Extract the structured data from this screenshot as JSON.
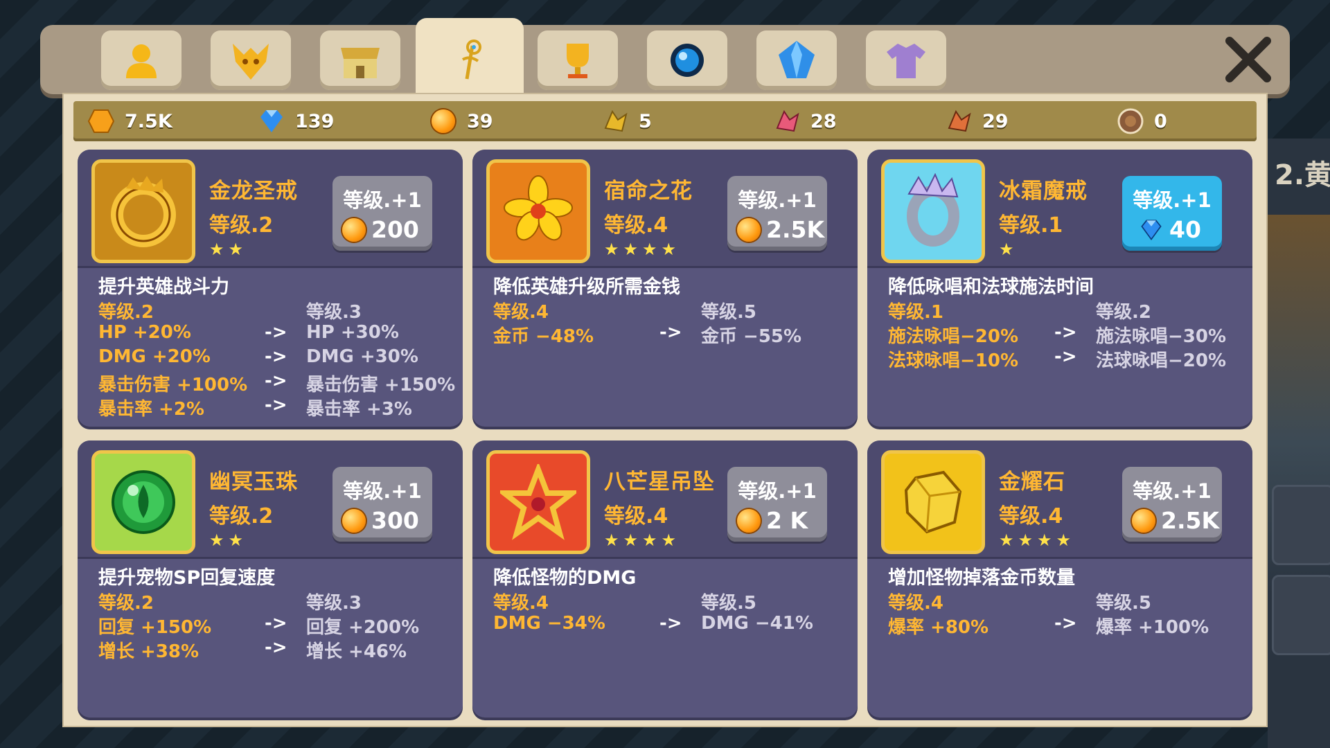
{
  "tabs": [
    {
      "icon": "hero-icon",
      "active": false
    },
    {
      "icon": "dragon-mask-icon",
      "active": false
    },
    {
      "icon": "shop-icon",
      "active": false
    },
    {
      "icon": "artifact-staff-icon",
      "active": true
    },
    {
      "icon": "trophy-icon",
      "active": false
    },
    {
      "icon": "orb-icon",
      "active": false
    },
    {
      "icon": "gem-icon",
      "active": false
    },
    {
      "icon": "shirt-icon",
      "active": false
    }
  ],
  "resources": [
    {
      "icon": "gold-coin-icon",
      "value": "7.5K"
    },
    {
      "icon": "diamond-icon",
      "value": "139"
    },
    {
      "icon": "orange-orb-icon",
      "value": "39"
    },
    {
      "icon": "yellow-fragment-icon",
      "value": "5"
    },
    {
      "icon": "pink-fragment-icon",
      "value": "28"
    },
    {
      "icon": "red-fragment-icon",
      "value": "29"
    },
    {
      "icon": "brown-token-icon",
      "value": "0"
    }
  ],
  "cards": [
    {
      "name": "金龙圣戒",
      "level": "等级.2",
      "stars": "★★",
      "upgrade_label": "等级.+1",
      "cost": "200",
      "cost_currency": "orange-orb",
      "desc": "提升英雄战斗力",
      "header_cur": "等级.2",
      "header_next": "等级.3",
      "rows": [
        {
          "cur": "HP +20%",
          "arrow": "->",
          "next": "HP +30%"
        },
        {
          "cur": "DMG +20%",
          "arrow": "->",
          "next": "DMG +30%"
        },
        {
          "cur": "暴击伤害 +100%",
          "arrow": "->",
          "next": "暴击伤害 +150%"
        },
        {
          "cur": "暴击率 +2%",
          "arrow": "->",
          "next": "暴击率 +3%"
        }
      ]
    },
    {
      "name": "宿命之花",
      "level": "等级.4",
      "stars": "★★★★",
      "upgrade_label": "等级.+1",
      "cost": "2.5K",
      "cost_currency": "orange-orb",
      "desc": "降低英雄升级所需金钱",
      "header_cur": "等级.4",
      "header_next": "等级.5",
      "rows": [
        {
          "cur": "金币 −48%",
          "arrow": "->",
          "next": "金币 −55%"
        }
      ]
    },
    {
      "name": "冰霜魔戒",
      "level": "等级.1",
      "stars": "★",
      "upgrade_label": "等级.+1",
      "cost": "40",
      "cost_currency": "diamond",
      "desc": "降低咏唱和法球施法时间",
      "header_cur": "等级.1",
      "header_next": "等级.2",
      "rows": [
        {
          "cur": "施法咏唱−20%",
          "arrow": "->",
          "next": "施法咏唱−30%"
        },
        {
          "cur": "法球咏唱−10%",
          "arrow": "->",
          "next": "法球咏唱−20%"
        }
      ]
    },
    {
      "name": "幽冥玉珠",
      "level": "等级.2",
      "stars": "★★",
      "upgrade_label": "等级.+1",
      "cost": "300",
      "cost_currency": "orange-orb",
      "desc": "提升宠物SP回复速度",
      "header_cur": "等级.2",
      "header_next": "等级.3",
      "rows": [
        {
          "cur": "回复 +150%",
          "arrow": "->",
          "next": "回复 +200%"
        },
        {
          "cur": "增长 +38%",
          "arrow": "->",
          "next": "增长 +46%"
        }
      ]
    },
    {
      "name": "八芒星吊坠",
      "level": "等级.4",
      "stars": "★★★★",
      "upgrade_label": "等级.+1",
      "cost": "2 K",
      "cost_currency": "orange-orb",
      "desc": "降低怪物的DMG",
      "header_cur": "等级.4",
      "header_next": "等级.5",
      "rows": [
        {
          "cur": "DMG −34%",
          "arrow": "->",
          "next": "DMG −41%"
        }
      ]
    },
    {
      "name": "金耀石",
      "level": "等级.4",
      "stars": "★★★★",
      "upgrade_label": "等级.+1",
      "cost": "2.5K",
      "cost_currency": "orange-orb",
      "desc": "增加怪物掉落金币数量",
      "header_cur": "等级.4",
      "header_next": "等级.5",
      "rows": [
        {
          "cur": "爆率 +80%",
          "arrow": "->",
          "next": "爆率 +100%"
        }
      ]
    }
  ],
  "side_panel": {
    "title_peek": "2.黄|"
  },
  "colors": {
    "accent_text": "#ffb733",
    "card_bg": "#58557c",
    "upgrade_gray": "#8f8e9a",
    "upgrade_blue": "#33b7ea",
    "resource_bar": "#a08a4a"
  }
}
